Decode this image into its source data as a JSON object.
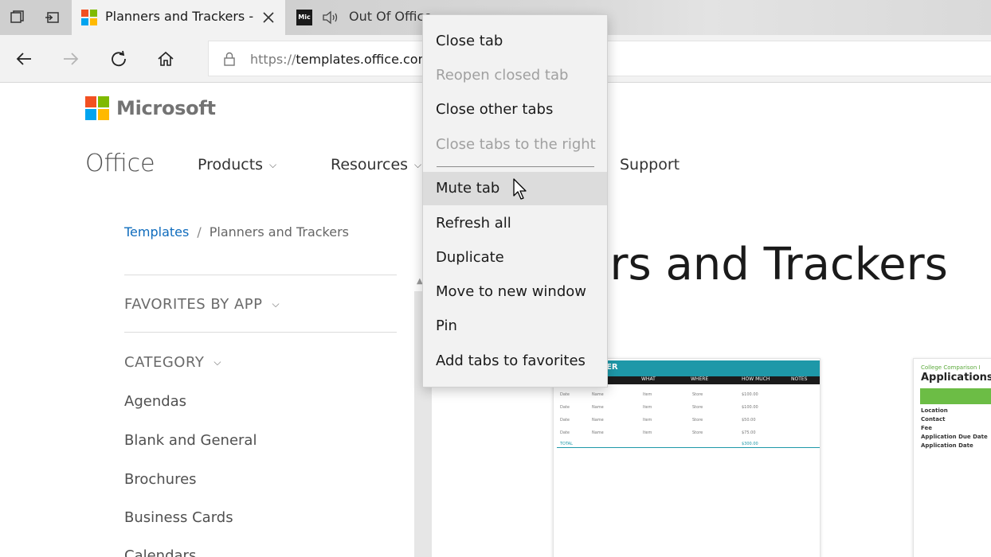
{
  "browser": {
    "tabs": [
      {
        "title": "Planners and Trackers -",
        "icon": "microsoft-logo-icon",
        "active": true,
        "close_icon": "close-icon"
      },
      {
        "title": "Out Of Office...",
        "favicon_text": "Mic",
        "icon": "speaker-icon",
        "active": false
      }
    ],
    "address_bar": {
      "url_scheme": "https://",
      "url_host": "templates.office.com",
      "lock_icon": "lock-icon"
    },
    "nav_icons": [
      "back-arrow-icon",
      "forward-arrow-icon",
      "refresh-icon",
      "home-icon"
    ]
  },
  "context_menu": {
    "items": [
      {
        "label": "Close tab",
        "enabled": true
      },
      {
        "label": "Reopen closed tab",
        "enabled": false
      },
      {
        "label": "Close other tabs",
        "enabled": true
      },
      {
        "label": "Close tabs to the right",
        "enabled": false
      },
      {
        "label": "Mute tab",
        "enabled": true,
        "hovered": true
      },
      {
        "label": "Refresh all",
        "enabled": true
      },
      {
        "label": "Duplicate",
        "enabled": true
      },
      {
        "label": "Move to new window",
        "enabled": true
      },
      {
        "label": "Pin",
        "enabled": true
      },
      {
        "label": "Add tabs to favorites",
        "enabled": true
      }
    ]
  },
  "page": {
    "brand": "Microsoft",
    "office": "Office",
    "nav": {
      "products": "Products",
      "resources": "Resources",
      "support": "Support"
    },
    "breadcrumb": {
      "root": "Templates",
      "separator": "/",
      "current": "Planners and Trackers"
    },
    "favorites_heading": "FAVORITES BY APP",
    "category_heading": "CATEGORY",
    "categories": [
      "Agendas",
      "Blank and General",
      "Brochures",
      "Business Cards",
      "Calendars"
    ],
    "heading_visible": "nners and Trackers",
    "thumb1": {
      "title_fragment": "ER",
      "columns": [
        "WHAT",
        "WHERE",
        "HOW MUCH",
        "NOTES"
      ],
      "rows": [
        [
          "Date",
          "Name",
          "Item",
          "Store",
          "$100.00"
        ],
        [
          "Date",
          "Name",
          "Item",
          "Store",
          "$100.00"
        ],
        [
          "Date",
          "Name",
          "Item",
          "Store",
          "$50.00"
        ],
        [
          "Date",
          "Name",
          "Item",
          "Store",
          "$75.00"
        ]
      ],
      "total_label": "TOTAL",
      "total_value": "$300.00"
    },
    "thumb2": {
      "subtitle": "College Comparison I",
      "title": "Applications",
      "rows": [
        "Location",
        "Contact",
        "Fee",
        "Application Due Date",
        "Application Date"
      ]
    }
  },
  "colors": {
    "tabstrip": "#cfcfcf",
    "toolbar": "#f2f2f2",
    "link": "#0f6cbd",
    "teal": "#1e98a8",
    "green": "#6cbd45"
  }
}
